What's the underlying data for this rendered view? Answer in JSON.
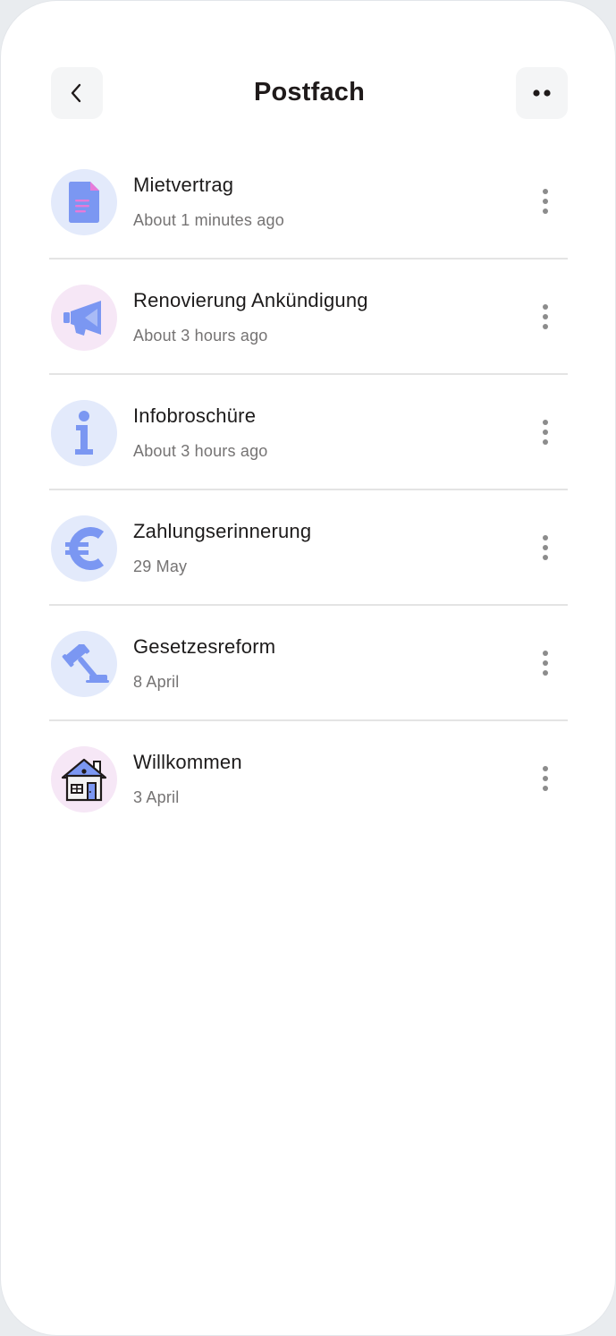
{
  "header": {
    "title": "Postfach",
    "back_icon": "chevron-left-icon",
    "menu_icon": "more-dots-icon"
  },
  "colors": {
    "icon_blue": "#7b97f2",
    "icon_pink": "#e77ad9",
    "avatar_blue_bg": "#e3eafb",
    "avatar_pink_bg": "#f6e7f6"
  },
  "messages": [
    {
      "title": "Mietvertrag",
      "time": "About 1 minutes ago",
      "icon": "document-icon"
    },
    {
      "title": "Renovierung Ankündigung",
      "time": "About 3 hours ago",
      "icon": "megaphone-icon"
    },
    {
      "title": "Infobroschüre",
      "time": "About 3 hours ago",
      "icon": "info-icon"
    },
    {
      "title": "Zahlungserinnerung",
      "time": "29 May",
      "icon": "euro-icon"
    },
    {
      "title": "Gesetzesreform",
      "time": "8 April",
      "icon": "gavel-icon"
    },
    {
      "title": "Willkommen",
      "time": "3 April",
      "icon": "house-icon"
    }
  ]
}
